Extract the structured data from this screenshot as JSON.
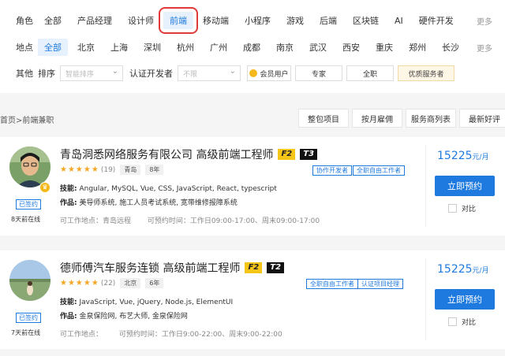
{
  "filters": {
    "role": {
      "label": "角色",
      "options": [
        "全部",
        "产品经理",
        "设计师",
        "前端",
        "移动端",
        "小程序",
        "游戏",
        "后端",
        "区块链",
        "AI",
        "硬件开发"
      ],
      "selected": "前端",
      "more": "更多"
    },
    "location": {
      "label": "地点",
      "options": [
        "全部",
        "北京",
        "上海",
        "深圳",
        "杭州",
        "广州",
        "成都",
        "南京",
        "武汉",
        "西安",
        "重庆",
        "郑州",
        "长沙"
      ],
      "selected": "全部",
      "more": "更多"
    },
    "other": {
      "label": "其他",
      "sort_label": "排序",
      "sort_placeholder": "智能排序",
      "certified_label": "认证开发者",
      "certified_placeholder": "不限",
      "tags": [
        "会员用户",
        "专家",
        "全职",
        "优质服务者"
      ]
    }
  },
  "breadcrumb": "首页>前端兼职",
  "sort_buttons": [
    "整包项目",
    "按月雇佣",
    "服务商列表",
    "最新好评"
  ],
  "developers": [
    {
      "title": "青岛洞悉网络服务有限公司 高级前端工程师",
      "level_f": "F2",
      "level_t": "T3",
      "stars": "★★★★★",
      "reviews": "(19)",
      "city": "青岛",
      "years": "8年",
      "badges": [
        "协作开发者",
        "全职自由工作者"
      ],
      "skills_label": "技能:",
      "skills": "Angular, MySQL, Vue, CSS, JavaScript, React, typescript",
      "works_label": "作品:",
      "works": "美导师系统, 施工人员考试系统, 宽带维修报障系统",
      "location_text": "可工作地点：青岛远程",
      "time_text": "可预约时间：工作日09:00-17:00、周末09:00-17:00",
      "signed": "已签约",
      "online": "8天前在线",
      "price": "15225",
      "price_unit": "元/月",
      "book_label": "立即预约",
      "compare_label": "对比"
    },
    {
      "title": "德师傅汽车服务连锁 高级前端工程师",
      "level_f": "F2",
      "level_t": "T2",
      "stars": "★★★★★",
      "reviews": "(22)",
      "city": "北京",
      "years": "6年",
      "badges": [
        "全职自由工作者",
        "认证项目经理"
      ],
      "skills_label": "技能:",
      "skills": "JavaScript, Vue, jQuery, Node.js, ElementUI",
      "works_label": "作品:",
      "works": "金泉保险网, 布艺大师, 金泉保险网",
      "location_text": "可工作地点：",
      "time_text": "可预约时间：工作日9:00-22:00、周末9:00-22:00",
      "signed": "已签约",
      "online": "7天前在线",
      "price": "15225",
      "price_unit": "元/月",
      "book_label": "立即预约",
      "compare_label": "对比"
    }
  ],
  "colors": {
    "accent": "#1f7ae0",
    "highlight_box": "#e03a3a",
    "star": "#f5a623",
    "level_f": "#f5c518",
    "level_t": "#111111"
  }
}
